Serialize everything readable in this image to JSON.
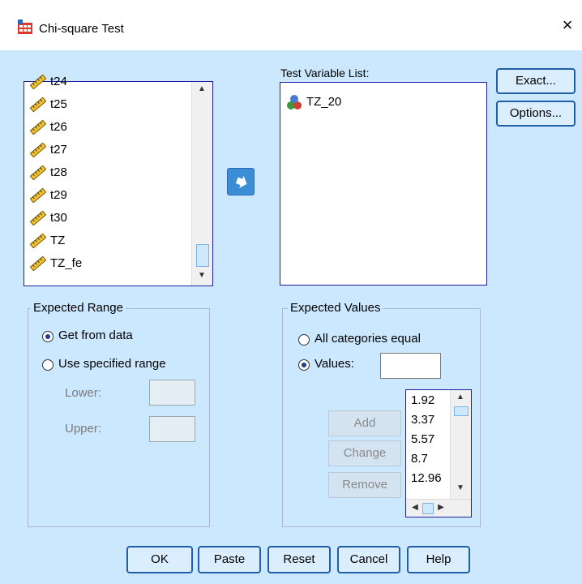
{
  "window": {
    "title": "Chi-square Test",
    "close_label": "×",
    "app_icon": "spss-chart-icon"
  },
  "source_list": {
    "items": [
      "t24",
      "t25",
      "t26",
      "t27",
      "t28",
      "t29",
      "t30",
      "TZ",
      "TZ_fe"
    ],
    "item_icon": "ruler-scale-icon"
  },
  "move_button": {
    "icon": "arrow-right-icon"
  },
  "test_variable_list": {
    "label": "Test Variable List:",
    "items": [
      "TZ_20"
    ],
    "item_icon": "nominal-variable-icon"
  },
  "side_buttons": {
    "exact": "Exact...",
    "options": "Options..."
  },
  "expected_range": {
    "legend": "Expected Range",
    "get_from_data": "Get from data",
    "use_specified": "Use specified range",
    "lower_label": "Lower:",
    "upper_label": "Upper:",
    "lower_value": "",
    "upper_value": "",
    "selected": "get_from_data"
  },
  "expected_values": {
    "legend": "Expected Values",
    "all_equal": "All categories equal",
    "values_label": "Values:",
    "values_input": "",
    "selected": "values",
    "list": [
      "1.92",
      "3.37",
      "5.57",
      "8.7",
      "12.96"
    ],
    "add": "Add",
    "change": "Change",
    "remove": "Remove"
  },
  "footer": {
    "ok": "OK",
    "paste": "Paste",
    "reset": "Reset",
    "cancel": "Cancel",
    "help": "Help"
  }
}
